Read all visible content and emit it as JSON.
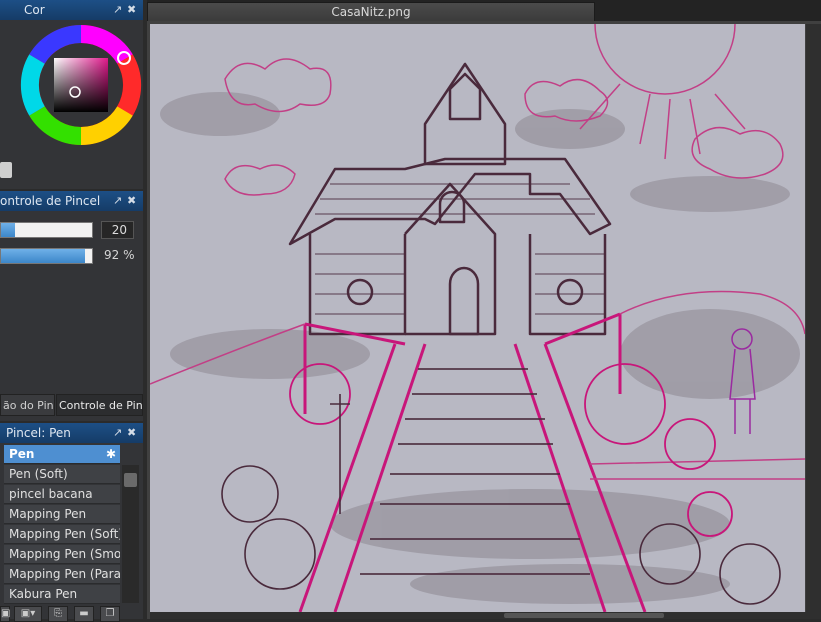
{
  "color_panel": {
    "title": "Cor",
    "float_icon": "↗",
    "close_icon": "✖"
  },
  "brush_control": {
    "title": "ontrole de Pincel",
    "size_value": "20",
    "opacity_value": "92 %",
    "size_fraction": 0.15,
    "opacity_fraction": 0.92
  },
  "panel_tabs": [
    "ão do Pincel",
    "Controle de Pincel"
  ],
  "brush_list": {
    "title": "Pincel: Pen",
    "gear_icon": "✱",
    "items": [
      "Pen",
      "Pen (Soft)",
      "pincel bacana",
      "Mapping Pen",
      "Mapping Pen (Soft)",
      "Mapping Pen (Smoot",
      "Mapping Pen (Paralle",
      "Kabura Pen"
    ],
    "selected_index": 0
  },
  "document": {
    "tab_title": "CasaNitz.png"
  },
  "colors": {
    "accent": "#4e8fd1",
    "title_bar": "#1d4f86",
    "canvas_bg": "#b8b8c3",
    "sketch_magenta": "#c8167a",
    "sketch_dark": "#4a2a3c"
  }
}
